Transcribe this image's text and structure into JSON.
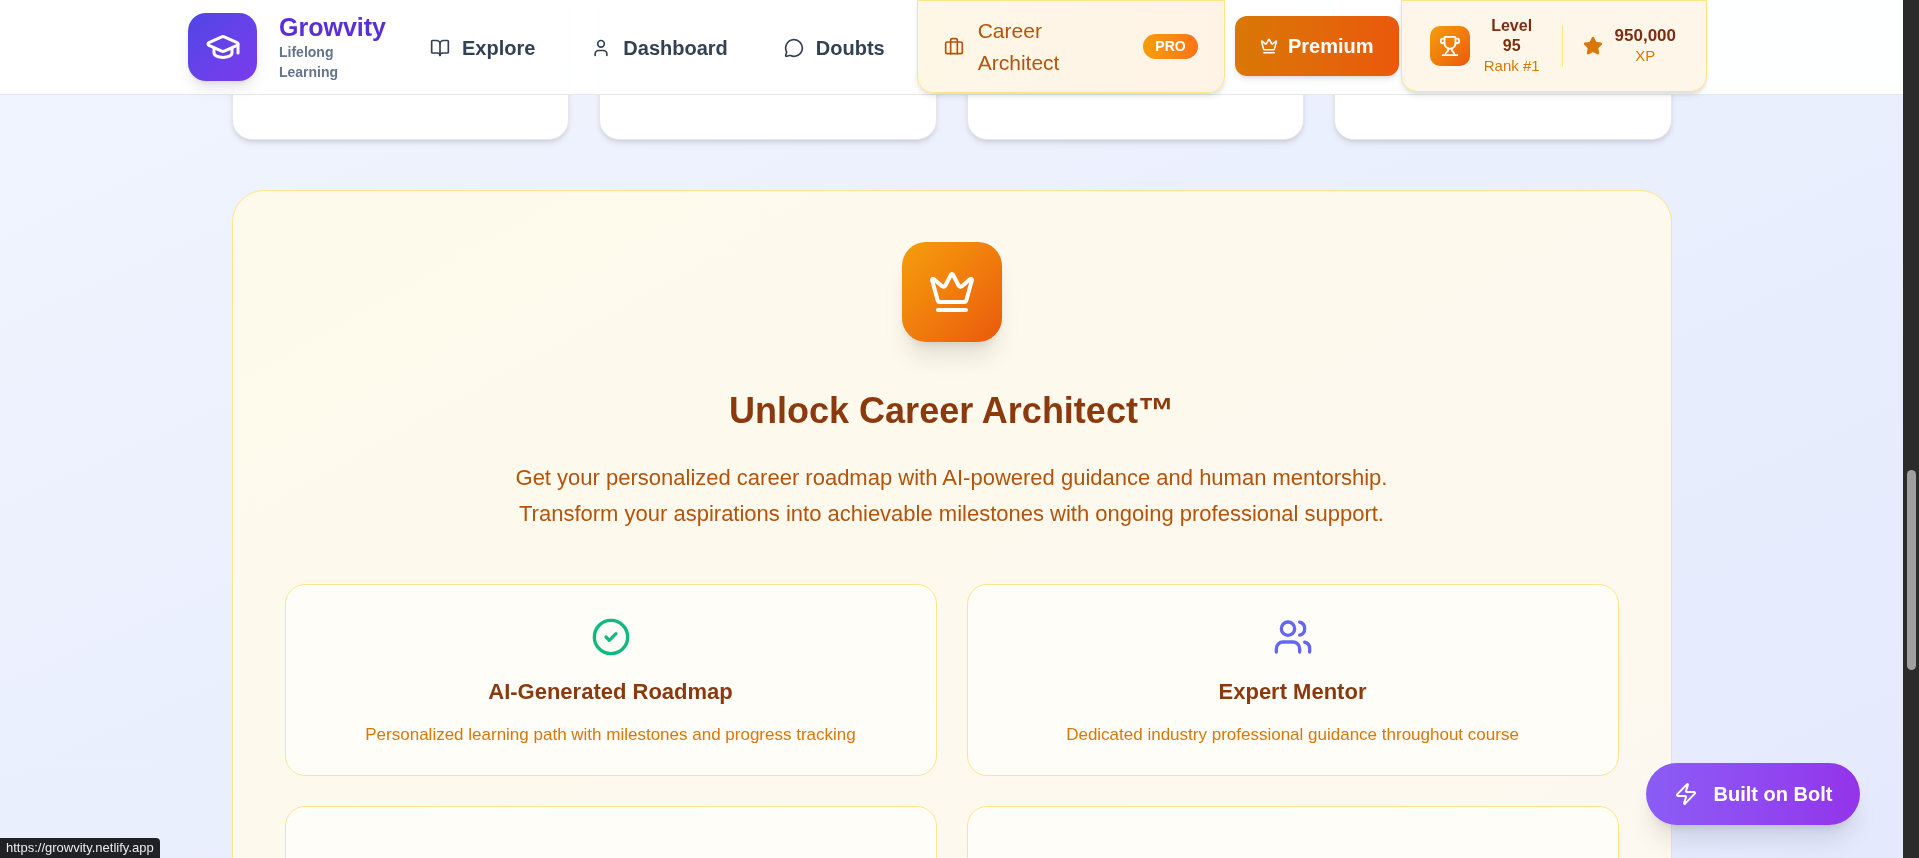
{
  "brand": {
    "name": "Growvity",
    "tagline": "Lifelong Learning"
  },
  "nav": [
    {
      "label": "Explore"
    },
    {
      "label": "Dashboard"
    },
    {
      "label": "Doubts"
    }
  ],
  "career_architect": {
    "label": "Career Architect",
    "badge": "PRO"
  },
  "premium_button": {
    "label": "Premium"
  },
  "level": {
    "label": "Level",
    "value": "95",
    "rank": "Rank #1"
  },
  "xp": {
    "value": "950,000",
    "label": "XP"
  },
  "hero": {
    "title": "Unlock Career Architect™",
    "description": "Get your personalized career roadmap with AI-powered guidance and human mentorship. Transform your aspirations into achievable milestones with ongoing professional support."
  },
  "features": [
    {
      "title": "AI-Generated Roadmap",
      "description": "Personalized learning path with milestones and progress tracking"
    },
    {
      "title": "Expert Mentor",
      "description": "Dedicated industry professional guidance throughout course"
    }
  ],
  "floating_button": {
    "label": "Built on Bolt"
  },
  "status_url": "https://growvity.netlify.app"
}
